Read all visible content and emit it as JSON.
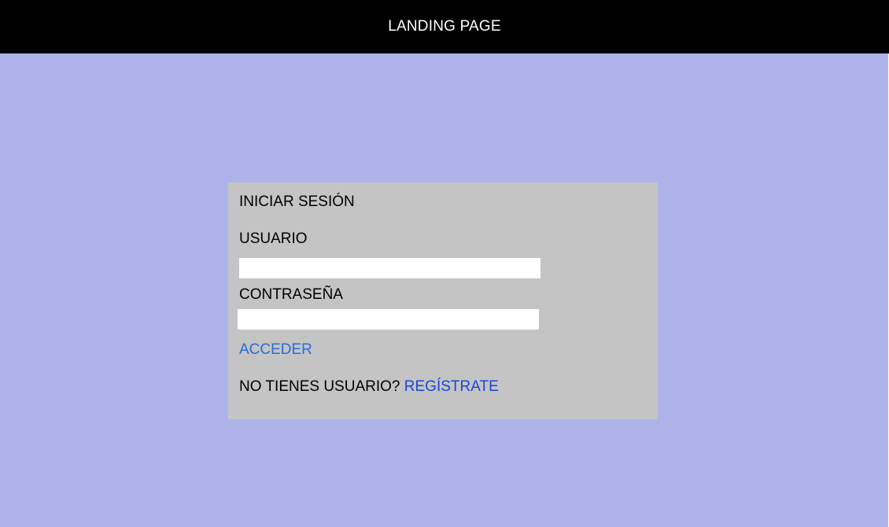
{
  "header": {
    "title": "LANDING PAGE"
  },
  "login": {
    "title": "INICIAR SESIÓN",
    "user_label": "USUARIO",
    "user_value": "",
    "password_label": "CONTRASEÑA",
    "password_value": "",
    "access_link": "ACCEDER",
    "no_account_text": "NO TIENES USUARIO?",
    "register_link": "REGÍSTRATE"
  },
  "colors": {
    "header_bg": "#000000",
    "page_bg": "#adb3e9",
    "card_bg": "#c4c4c4",
    "access_link": "#2a6bd8",
    "register_link": "#1947d6"
  }
}
